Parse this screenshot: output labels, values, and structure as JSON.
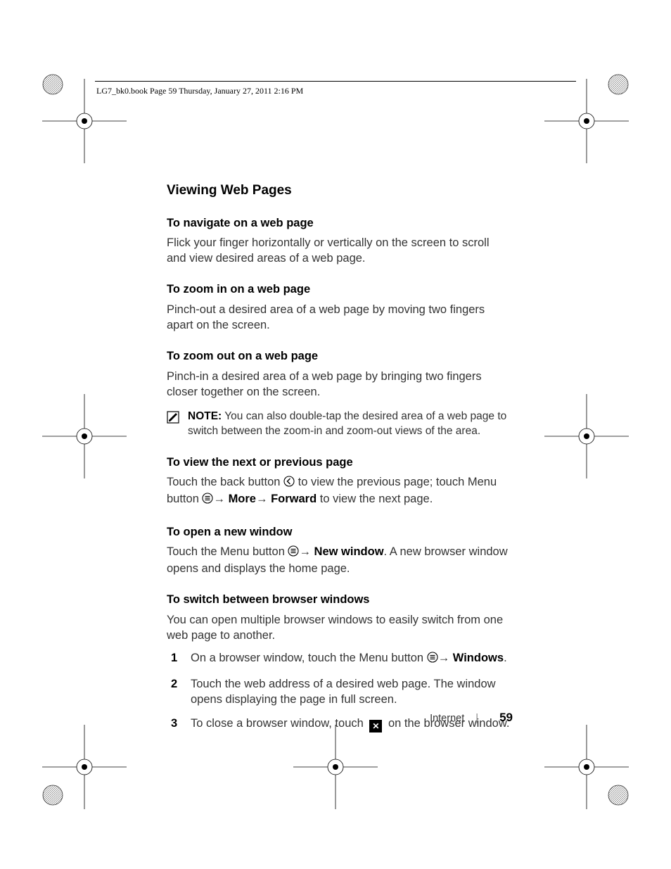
{
  "header": {
    "crop_text": "LG7_bk0.book  Page 59  Thursday, January 27, 2011  2:16 PM"
  },
  "title": "Viewing Web Pages",
  "sections": {
    "navigate": {
      "head": "To navigate on a web page",
      "body": "Flick your finger horizontally or vertically on the screen to scroll and view desired areas of a web page."
    },
    "zoom_in": {
      "head": "To zoom in on a web page",
      "body": "Pinch-out a desired area of a web page by moving two fingers apart on the screen."
    },
    "zoom_out": {
      "head": "To zoom out on a web page",
      "body": "Pinch-in a desired area of a web page by bringing two fingers closer together on the screen."
    },
    "note": {
      "label": "NOTE:",
      "body": " You can also double-tap the desired area of a web page to switch between the zoom-in and zoom-out views of the area."
    },
    "next_prev": {
      "head": "To view the next or previous page",
      "pre": "Touch the back button ",
      "mid": " to view the previous page; touch Menu button ",
      "more": "More",
      "forward": "Forward",
      "post": " to view the next page."
    },
    "new_window": {
      "head": "To open a new window",
      "pre": "Touch the Menu button ",
      "bold": "New window",
      "post": ". A new browser window opens and displays the home page."
    },
    "switch": {
      "head": "To switch between browser windows",
      "intro": "You can open multiple browser windows to easily switch from one web page to another.",
      "step1_pre": "On a browser window, touch the Menu button ",
      "step1_bold": "Windows",
      "step1_post": ".",
      "step2": "Touch the web address of a desired web page. The window opens displaying the page in full screen.",
      "step3_pre": "To close a browser window, touch ",
      "step3_post": " on the browser window."
    }
  },
  "footer": {
    "section": "Internet",
    "page": "59"
  }
}
